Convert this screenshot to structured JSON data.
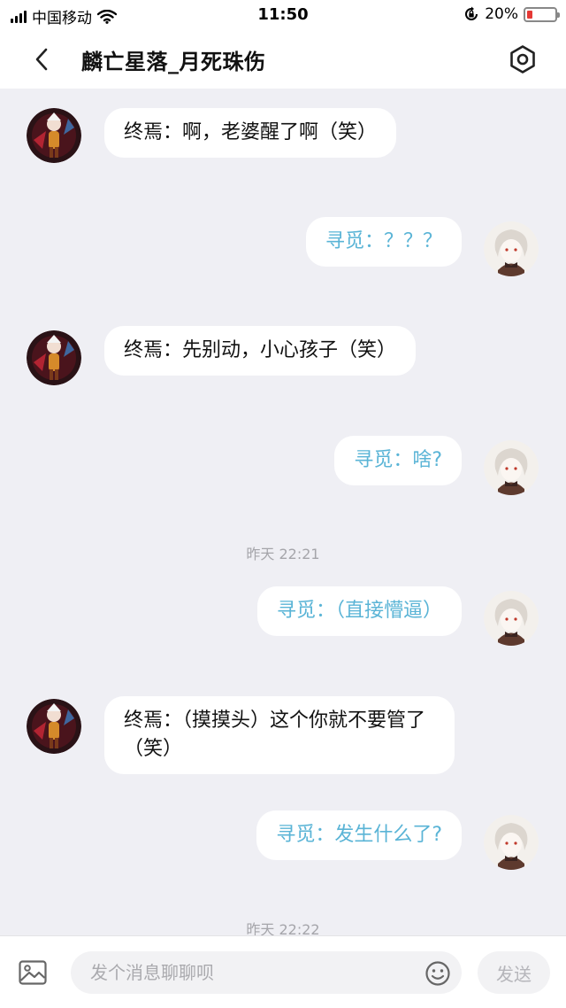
{
  "status_bar": {
    "carrier": "中国移动",
    "time": "11:50",
    "battery_percent": "20%",
    "battery_level": 0.2,
    "battery_color": "#e53935",
    "icons": [
      "signal-icon",
      "wifi-icon",
      "orientation-lock-icon",
      "battery-icon"
    ]
  },
  "header": {
    "title": "麟亡星落_月死珠伤",
    "back_icon": "chevron-left-icon",
    "settings_icon": "hexagon-settings-icon"
  },
  "colors": {
    "background": "#efeff4",
    "bubble": "#ffffff",
    "self_text": "#5ab4d6",
    "other_text": "#111111",
    "timestamp": "#a5a5aa"
  },
  "messages": [
    {
      "side": "left",
      "avatar": "character-avatar-red",
      "text": "终焉：啊，老婆醒了啊（笑）"
    },
    {
      "side": "right",
      "avatar": "character-avatar-white",
      "text": "寻觅：？？？"
    },
    {
      "side": "left",
      "avatar": "character-avatar-red",
      "text": "终焉：先别动，小心孩子（笑）"
    },
    {
      "side": "right",
      "avatar": "character-avatar-white",
      "text": "寻觅：啥?"
    },
    {
      "type": "timestamp",
      "text": "昨天 22:21"
    },
    {
      "side": "right",
      "avatar": "character-avatar-white",
      "text": "寻觅：（直接懵逼）"
    },
    {
      "side": "left",
      "avatar": "character-avatar-red",
      "text": "终焉：（摸摸头）这个你就不要管了（笑）"
    },
    {
      "side": "right",
      "avatar": "character-avatar-white",
      "text": "寻觅：发生什么了?"
    },
    {
      "type": "timestamp",
      "text": "昨天 22:22"
    }
  ],
  "input_bar": {
    "placeholder": "发个消息聊聊呗",
    "value": "",
    "send_label": "发送",
    "image_icon": "image-icon",
    "emoji_icon": "emoji-icon"
  }
}
